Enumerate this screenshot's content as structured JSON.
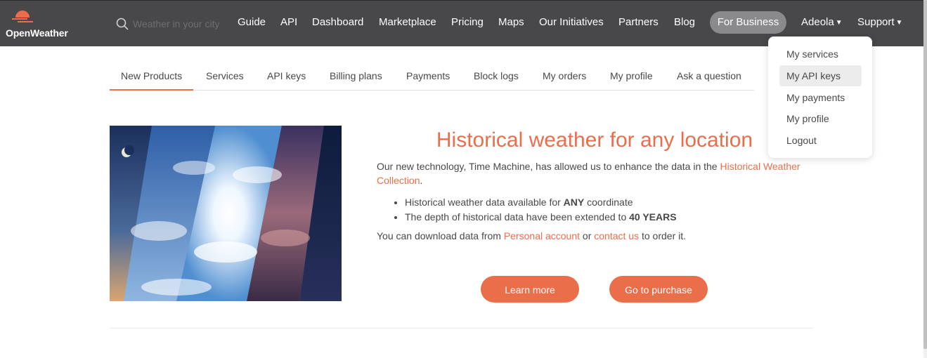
{
  "header": {
    "logo_text": "OpenWeather",
    "search": {
      "placeholder": "Weather in your city"
    },
    "nav": {
      "guide": "Guide",
      "api": "API",
      "dashboard": "Dashboard",
      "marketplace": "Marketplace",
      "pricing": "Pricing",
      "maps": "Maps",
      "initiatives": "Our Initiatives",
      "partners": "Partners",
      "blog": "Blog",
      "for_business": "For Business",
      "user": "Adeola",
      "support": "Support"
    }
  },
  "user_menu": {
    "items": [
      "My services",
      "My API keys",
      "My payments",
      "My profile",
      "Logout"
    ],
    "highlighted": "My API keys"
  },
  "tabs": {
    "items": [
      "New Products",
      "Services",
      "API keys",
      "Billing plans",
      "Payments",
      "Block logs",
      "My orders",
      "My profile",
      "Ask a question"
    ],
    "active": "New Products"
  },
  "promo": {
    "headline": "Historical weather for any location",
    "intro_text": "Our new technology, Time Machine, has allowed us to enhance the data in the",
    "intro_link": "Historical Weather Collection",
    "intro_end": ".",
    "feature_1_prefix": "Historical weather data available for",
    "feature_1_bold": "ANY",
    "feature_1_suffix": "coordinate",
    "feature_2_prefix": "The depth of historical data have been extended to",
    "feature_2_bold": "40 YEARS",
    "download_prefix": "You can download data from",
    "download_link_1": "Personal account",
    "download_mid": "or",
    "download_link_2": "contact us",
    "download_suffix": "to order it.",
    "learn_more_label": "Learn more",
    "purchase_label": "Go to purchase"
  },
  "colors": {
    "accent": "#eb6e4b",
    "header_bg": "#48484a",
    "text": "#48484a",
    "for_business_bg": "#8a8a8c"
  },
  "icons": [
    "openweather-logo-icon",
    "search-icon",
    "caret-down-icon"
  ]
}
